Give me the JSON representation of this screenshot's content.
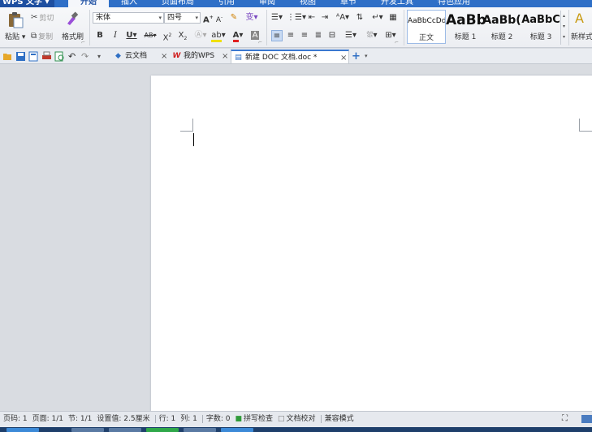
{
  "app": {
    "menu_label": "WPS 文字 ▾"
  },
  "menu_tabs": [
    "开始",
    "插入",
    "页面布局",
    "引用",
    "审阅",
    "视图",
    "章节",
    "开发工具",
    "特色应用"
  ],
  "ribbon": {
    "paste_label": "粘贴",
    "cut_label": "剪切",
    "copy_label": "复制",
    "format_painter_label": "格式刷",
    "font_name": "宋体",
    "font_size": "四号",
    "styles": [
      {
        "sample": "AaBbCcDd",
        "name": "正文"
      },
      {
        "sample": "AaBb",
        "name": "标题 1"
      },
      {
        "sample": "AaBb(",
        "name": "标题 2"
      },
      {
        "sample": "AaBbC",
        "name": "标题 3"
      }
    ],
    "new_style_sample": "A",
    "new_style_label": "新样式"
  },
  "doc_tabs": [
    {
      "label": "云文档",
      "icon": "cloud-icon"
    },
    {
      "label": "我的WPS",
      "icon": "wps-logo-icon"
    },
    {
      "label": "新建 DOC 文档.doc *",
      "icon": "document-icon"
    }
  ],
  "status": {
    "page_code": "页码: 1",
    "page_count": "页面: 1/1",
    "section": "节: 1/1",
    "setting": "设置值: 2.5厘米",
    "row": "行: 1",
    "col": "列: 1",
    "word_count": "字数: 0",
    "spell_check": "拼写检查",
    "doc_proof": "文档校对",
    "compat_mode": "兼容模式"
  },
  "colors": {
    "menubar": "#2e6fc7",
    "active_tab_text": "#2455a6",
    "highlight": "#f0e000",
    "font_color": "#e02020"
  }
}
